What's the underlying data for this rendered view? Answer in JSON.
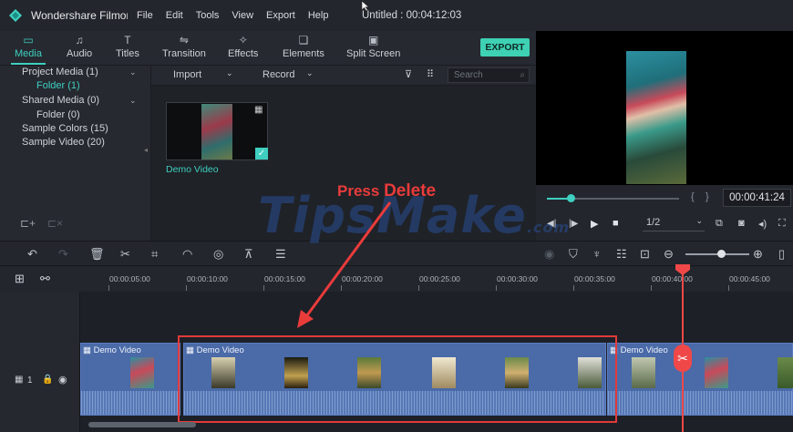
{
  "titlebar": {
    "app_name": "Wondershare Filmora",
    "menu": [
      "File",
      "Edit",
      "Tools",
      "View",
      "Export",
      "Help"
    ],
    "doc_title": "Untitled : 00:04:12:03"
  },
  "tabs": [
    {
      "label": "Media",
      "icon": "folder-icon"
    },
    {
      "label": "Audio",
      "icon": "music-note-icon"
    },
    {
      "label": "Titles",
      "icon": "text-icon"
    },
    {
      "label": "Transition",
      "icon": "transition-icon"
    },
    {
      "label": "Effects",
      "icon": "effects-icon"
    },
    {
      "label": "Elements",
      "icon": "elements-icon"
    },
    {
      "label": "Split Screen",
      "icon": "split-screen-icon"
    }
  ],
  "export_label": "EXPORT",
  "library": [
    {
      "label": "Project Media (1)"
    },
    {
      "label": "Folder (1)"
    },
    {
      "label": "Shared Media (0)"
    },
    {
      "label": "Folder (0)"
    },
    {
      "label": "Sample Colors (15)"
    },
    {
      "label": "Sample Video (20)"
    }
  ],
  "mediabar": {
    "import": "Import",
    "record": "Record",
    "search_placeholder": "Search"
  },
  "media_item": {
    "name": "Demo Video"
  },
  "preview": {
    "timecode": "00:00:41:24",
    "quality": "1/2",
    "progress": 0.18
  },
  "ruler_ticks": [
    "00:00:05:00",
    "00:00:10:00",
    "00:00:15:00",
    "00:00:20:00",
    "00:00:25:00",
    "00:00:30:00",
    "00:00:35:00",
    "00:00:40:00",
    "00:00:45:00"
  ],
  "track": {
    "number": "1"
  },
  "clips": [
    {
      "label": "Demo Video"
    },
    {
      "label": "Demo Video"
    },
    {
      "label": "Demo Video"
    }
  ],
  "annotation": {
    "press": "Press",
    "key": "Delete"
  },
  "watermark": "TipsMake",
  "watermark_suffix": ".com",
  "colors": {
    "accent": "#3fcfc0",
    "clip": "#4a6aa8",
    "highlight": "#e23a3a",
    "playhead": "#f04848"
  }
}
